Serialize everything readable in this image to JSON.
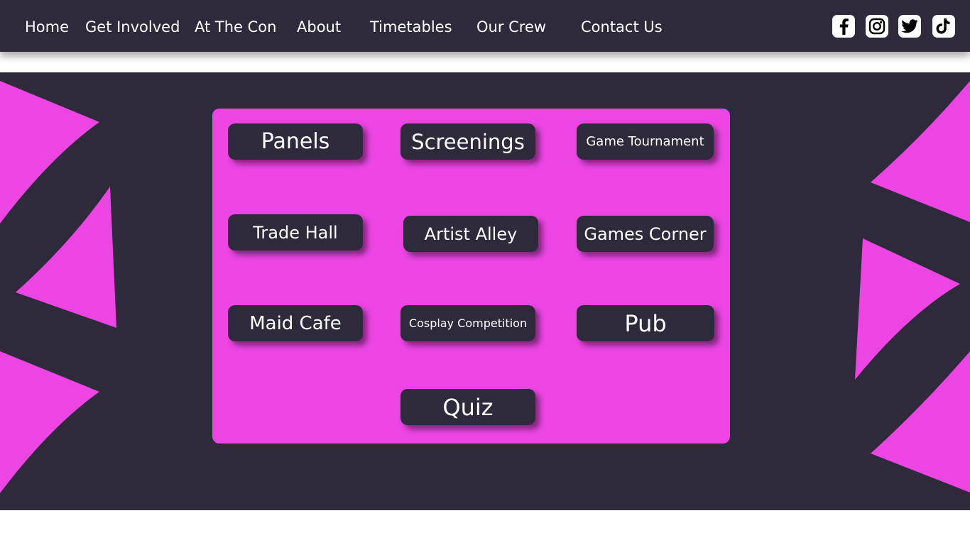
{
  "nav": {
    "items": [
      {
        "label": "Home"
      },
      {
        "label": "Get Involved"
      },
      {
        "label": "At The Con"
      },
      {
        "label": "About"
      },
      {
        "label": "Timetables"
      },
      {
        "label": "Our Crew"
      },
      {
        "label": "Contact Us"
      }
    ],
    "social": [
      {
        "icon": "facebook-icon"
      },
      {
        "icon": "instagram-icon"
      },
      {
        "icon": "twitter-icon"
      },
      {
        "icon": "tiktok-icon"
      }
    ]
  },
  "activities": [
    {
      "label": "Panels"
    },
    {
      "label": "Screenings"
    },
    {
      "label": "Game Tournament"
    },
    {
      "label": "Trade Hall"
    },
    {
      "label": "Artist Alley"
    },
    {
      "label": "Games Corner"
    },
    {
      "label": "Maid Cafe"
    },
    {
      "label": "Cosplay Competition"
    },
    {
      "label": "Pub"
    },
    {
      "label": "Quiz"
    }
  ],
  "colors": {
    "background_dark": "#2e2a3b",
    "accent_pink": "#ec45e4",
    "text": "#ffffff"
  }
}
